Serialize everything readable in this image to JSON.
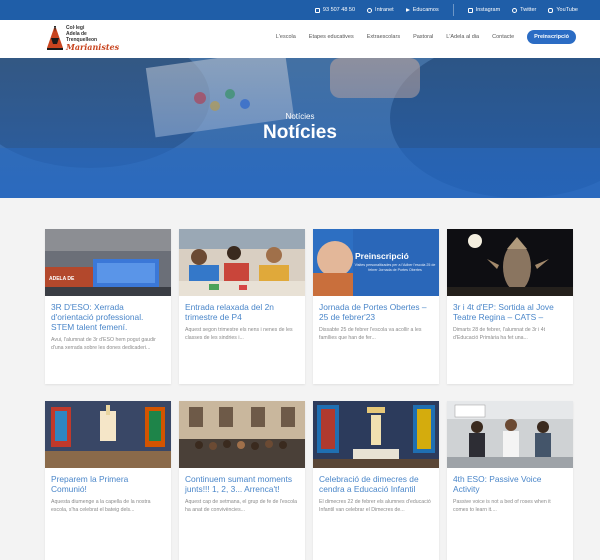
{
  "topbar": {
    "phone": "93 507 48 50",
    "intranet": "Intranet",
    "educamos": "Educamos",
    "instagram": "Instagram",
    "twitter": "Twitter",
    "youtube": "YouTube"
  },
  "logo": {
    "line1": "Col·legi",
    "line2": "Adela de",
    "line3": "Trenquelleon",
    "line4": "Marianistes"
  },
  "nav": {
    "items": [
      "L'escola",
      "Etapes educatives",
      "Extraescolars",
      "Pastoral",
      "L'Adela al dia",
      "Contacte"
    ],
    "cta": "Preinscripció"
  },
  "hero": {
    "breadcrumb": "Notícies",
    "title": "Notícies"
  },
  "cards": [
    {
      "title": "3R D'ESO: Xerrada d'orientació professional. STEM talent femení.",
      "excerpt": "Avui, l'alumnat de 3r d'ESO hem pogut gaudir d'una xerrada sobre les dones dedicaderi...",
      "image_text": "ADELA DE",
      "image_kind": "classroom-screen"
    },
    {
      "title": "Entrada relaxada del 2n trimestre de P4",
      "excerpt": "Aquest segon trimestre els nens i nenes de les classes de les sindries i...",
      "image_text": "",
      "image_kind": "kids-table"
    },
    {
      "title": "Jornada de Portes Obertes – 25 de febrer'23",
      "excerpt": "Dissabte 25 de febrer l'escola va acollir a les famílies que han de fer...",
      "image_text": "Preinscripció",
      "image_subtext": "Visites personalitzades per a l'Adber l'escola 25 de febrer Jornada de Portes Obertes",
      "image_kind": "preinscripcio"
    },
    {
      "title": "3r i 4t d'EP: Sortida al Jove Teatre Regina – CATS –",
      "excerpt": "Dimarts 28 de febrer, l'alumnat de 3r i 4t d'Educació Primària ha fet una...",
      "image_text": "",
      "image_kind": "theatre"
    },
    {
      "title": "Preparem la Primera Comunió!",
      "excerpt": "Aquesta diumenge a la capella de la nostra escola, s'ha celebrat el bateig dels...",
      "image_text": "",
      "image_kind": "chapel"
    },
    {
      "title": "Continuem sumant moments junts!!! 1, 2, 3... Arrenca't!",
      "excerpt": "Aquest cap de setmana, el grup de fe de l'escola ha anat de convivències...",
      "image_text": "",
      "image_kind": "group-building"
    },
    {
      "title": "Celebració de dimecres de cendra a Educació Infantil",
      "excerpt": "El dimecres 22 de febrer els alumnes d'educació Infantil van celebrar el Dimecres de...",
      "image_text": "",
      "image_kind": "chapel-altar"
    },
    {
      "title": "4th ESO: Passive Voice Activity",
      "excerpt": "Passive voice is not a bed of roses when it comes to learn it....",
      "image_text": "",
      "image_kind": "classroom-students"
    }
  ],
  "colors": {
    "brand_blue": "#1f5ea8",
    "link_blue": "#4a86c9",
    "cta_blue": "#2b6cc4",
    "logo_accent": "#c8441f"
  }
}
